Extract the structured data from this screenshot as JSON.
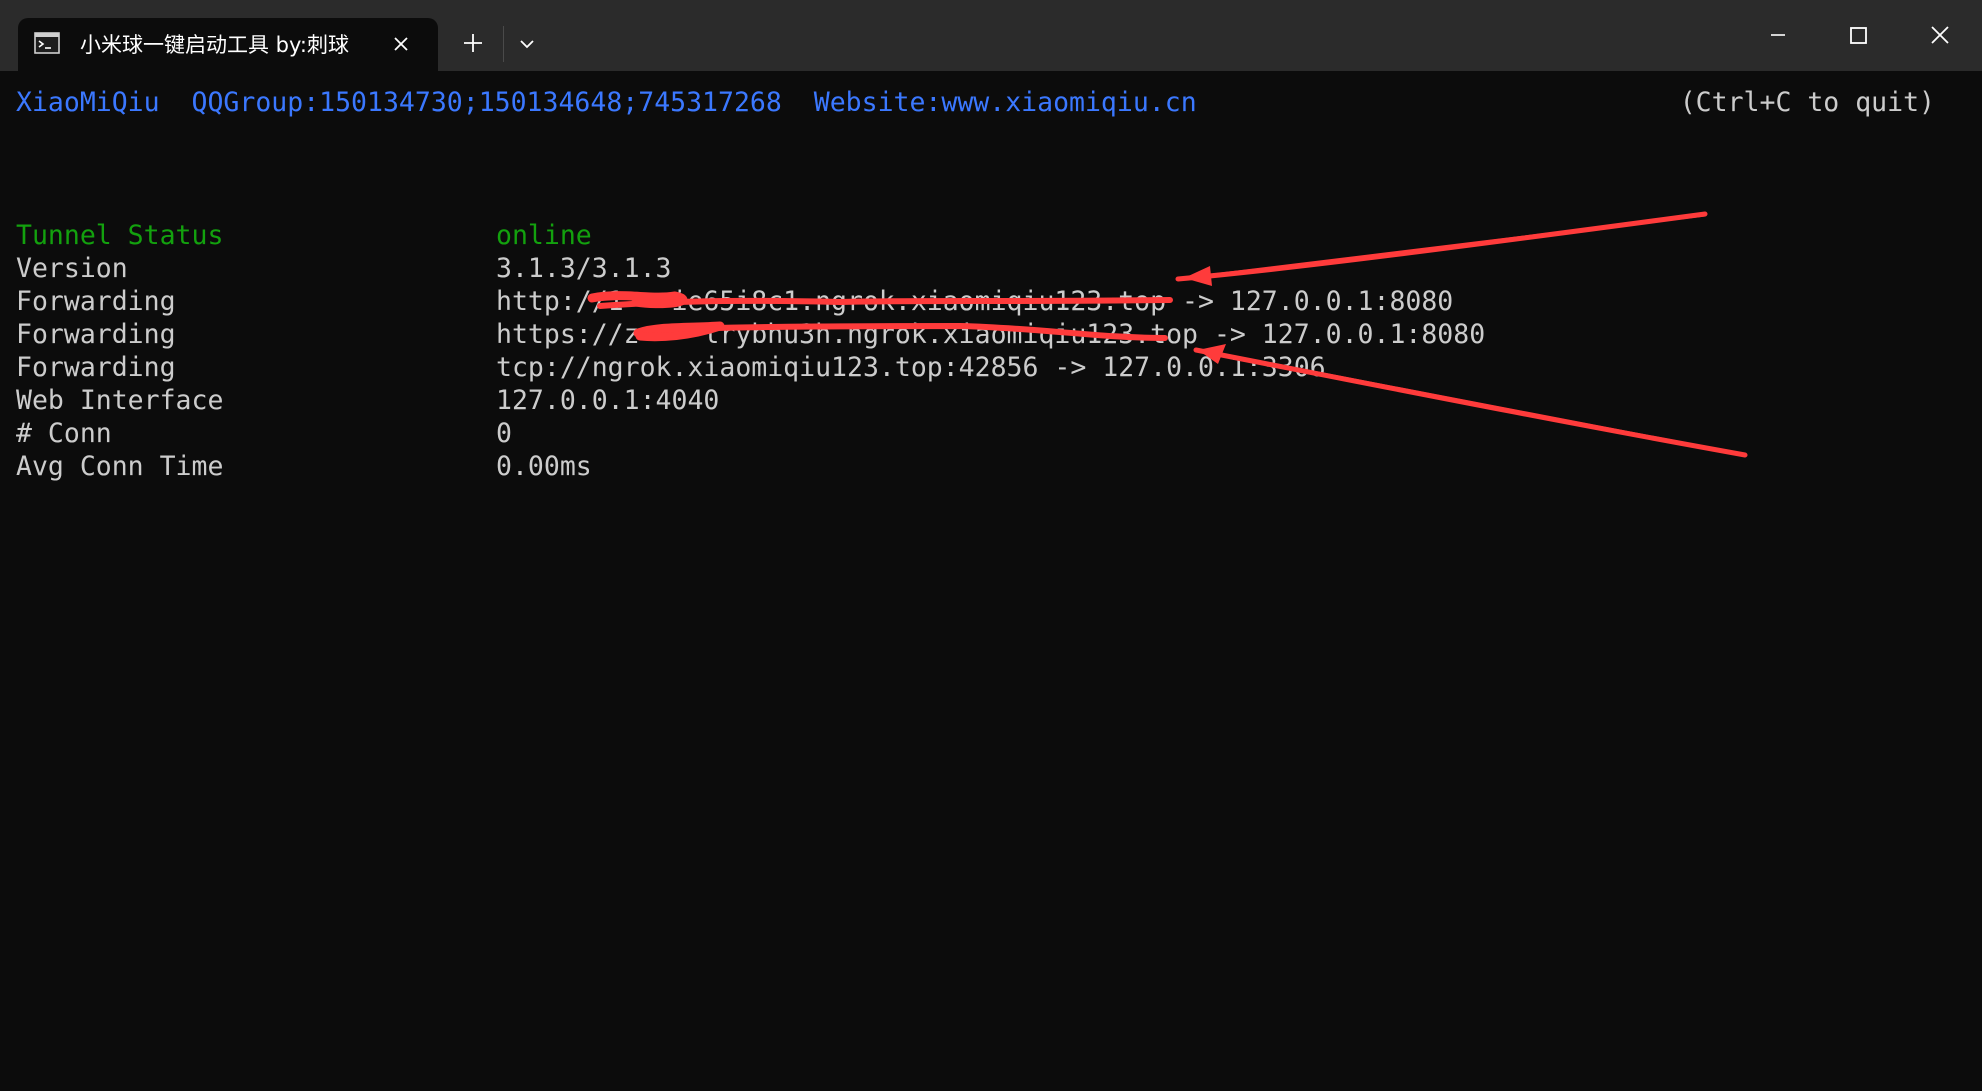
{
  "window": {
    "tab_title": "小米球一键启动工具 by:刺球"
  },
  "terminal": {
    "banner_app": "XiaoMiQiu",
    "banner_qq": "QQGroup:150134730;150134648;745317268",
    "banner_site": "Website:www.xiaomiqiu.cn",
    "quit_hint": "(Ctrl+C to quit)",
    "status_rows": [
      {
        "key": "Tunnel Status",
        "value": "online"
      },
      {
        "key": "Version",
        "value": "3.1.3/3.1.3"
      },
      {
        "key": "Forwarding",
        "value": "http://1   ie65i8c1.ngrok.xiaomiqiu123.top -> 127.0.0.1:8080"
      },
      {
        "key": "Forwarding",
        "value": "https://z    lrybhu3h.ngrok.xiaomiqiu123.top -> 127.0.0.1:8080"
      },
      {
        "key": "Forwarding",
        "value": "tcp://ngrok.xiaomiqiu123.top:42856 -> 127.0.0.1:3306"
      },
      {
        "key": "Web Interface",
        "value": "127.0.0.1:4040"
      },
      {
        "key": "# Conn",
        "value": "0"
      },
      {
        "key": "Avg Conn Time",
        "value": "0.00ms"
      }
    ]
  },
  "colors": {
    "accent_blue": "#3b78ff",
    "status_green": "#13a10e",
    "annotation_red": "#ff3b3b"
  }
}
